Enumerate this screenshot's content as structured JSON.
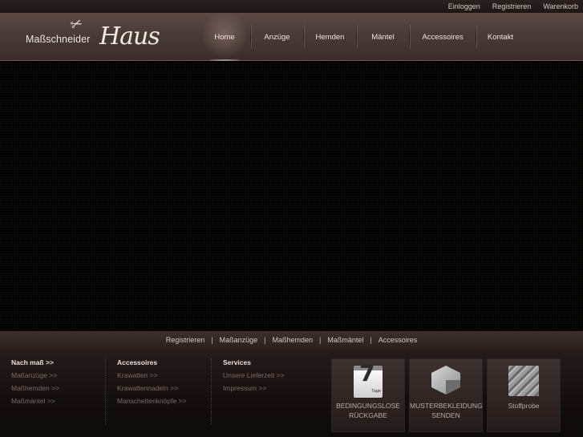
{
  "topbar": {
    "items": [
      "Einloggen",
      "Registrieren",
      "Warenkorb"
    ]
  },
  "logo": {
    "word1": "Maßschneider",
    "word2": "Haus"
  },
  "nav": {
    "items": [
      {
        "label": "Home",
        "active": true
      },
      {
        "label": "Anzüge"
      },
      {
        "label": "Hemden"
      },
      {
        "label": "Mäntel"
      },
      {
        "label": "Accessoires"
      },
      {
        "label": "Kontakt"
      }
    ]
  },
  "linkstrip": {
    "items": [
      "Registrieren",
      "Maßanzüge",
      "Maßhemden",
      "Maßmäntel",
      "Accessoires"
    ],
    "separator": "|"
  },
  "footer": {
    "col1": {
      "title": "Nach maß >>",
      "links": [
        "Maßanzüge >>",
        "Maßhemden >>",
        "Maßmäntel >>"
      ]
    },
    "col2": {
      "title": "Accessoires",
      "links": [
        "Krawatten >>",
        "Krawattennadeln >>",
        "Manschettenknöpfe >>"
      ]
    },
    "col3": {
      "title": "Services",
      "links": [
        "Unsere Lieferzeit >>",
        "Impressum >>"
      ]
    },
    "promos": [
      {
        "icon": "calendar-icon",
        "icon_number": "7",
        "icon_caption": "Tage",
        "line1": "BEDINGUNGSLOSE",
        "line2": "RÜCKGABE"
      },
      {
        "icon": "package-icon",
        "line1": "MUSTERBEKLEIDUNG",
        "line2": "SENDEN"
      },
      {
        "icon": "fabric-swatch-icon",
        "line1": "Stoffprobe",
        "line2": ""
      }
    ]
  },
  "colors": {
    "header": "#4a3b38",
    "accent_text": "#ece1d9",
    "muted_link": "#7c6b64",
    "background": "#000000"
  }
}
